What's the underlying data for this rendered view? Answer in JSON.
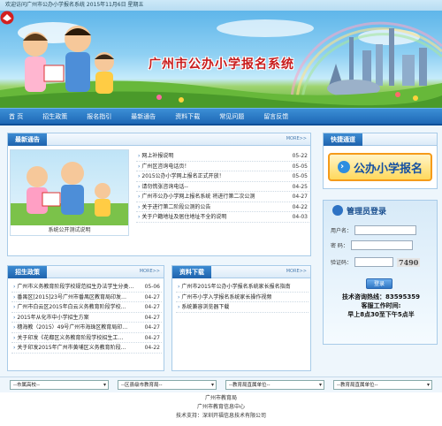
{
  "topbar": {
    "welcome": "欢迎访问广州市公办小学报名系统 2015年11月6日 星期五"
  },
  "banner": {
    "title": "广州市公办小学报名系统"
  },
  "nav": [
    "首 页",
    "招生政策",
    "报名指引",
    "最新通告",
    "资料下载",
    "常见问题",
    "留言反馈"
  ],
  "news": {
    "title": "最新通告",
    "more": "MORE>>",
    "image_caption": "系统公开测试说明",
    "items": [
      {
        "text": "网上补报说明",
        "date": "05-22"
      },
      {
        "text": "广州区咨询电话页！",
        "date": "05-05"
      },
      {
        "text": "2015公办小学网上报名正式开放！",
        "date": "05-05"
      },
      {
        "text": "请勿慌张咨询电话--",
        "date": "04-25"
      },
      {
        "text": "广州市公办小学网上报名系统 将进行第二次公测",
        "date": "04-27"
      },
      {
        "text": "关于进行第二阶段公测的公告",
        "date": "04-22"
      },
      {
        "text": "关于户籍地址及居住地址不全的说明",
        "date": "04-03"
      }
    ]
  },
  "policy": {
    "title": "招生政策",
    "more": "MORE>>",
    "items": [
      {
        "text": "广州市义务教育阶段学校规范招生办法学生分类…",
        "date": "05-06"
      },
      {
        "text": "番禺区[2015]23号广州市番禺区教育局印发…",
        "date": "04-27"
      },
      {
        "text": "广州市白云区2015年白云义务教育阶段学校…",
        "date": "04-27"
      },
      {
        "text": "2015年从化市中小学招生方案",
        "date": "04-27"
      },
      {
        "text": "穗海教（2015）49号广州市海珠区教育局印…",
        "date": "04-27"
      },
      {
        "text": "关于印发《花都区义务教育阶段学校招生工…",
        "date": "04-27"
      },
      {
        "text": "关于印发2015年广州市黄埔区义务教育阶段…",
        "date": "04-22"
      }
    ]
  },
  "download": {
    "title": "资料下载",
    "more": "MORE>>",
    "items": [
      {
        "text": "广州市2015年公办小学报名系统家长报名指南",
        "date": ""
      },
      {
        "text": "广州市小学入学报名系统家长操作视频",
        "date": ""
      },
      {
        "text": "系统兼容浏览器下载",
        "date": ""
      }
    ]
  },
  "quick": {
    "title": "快捷通道",
    "button": "公办小学报名"
  },
  "login": {
    "title": "管理员登录",
    "user_label": "用户名：",
    "pass_label": "密  码：",
    "code_label": "验证码：",
    "code_value": "7490",
    "button": "登录",
    "hotline": "技术咨询热线：83595359",
    "hours_title": "客服工作时间:",
    "hours": "早上8点30至下午5点半"
  },
  "selects": [
    "--市属高校--",
    "--区县级市教育局--",
    "--教育局直属单位--",
    "--教育局直属单位--"
  ],
  "footer": {
    "line1": "广州市教育局",
    "line2": "广州市教育信息中心",
    "line3": "技术支持：深圳开福信息技术有限公司"
  }
}
